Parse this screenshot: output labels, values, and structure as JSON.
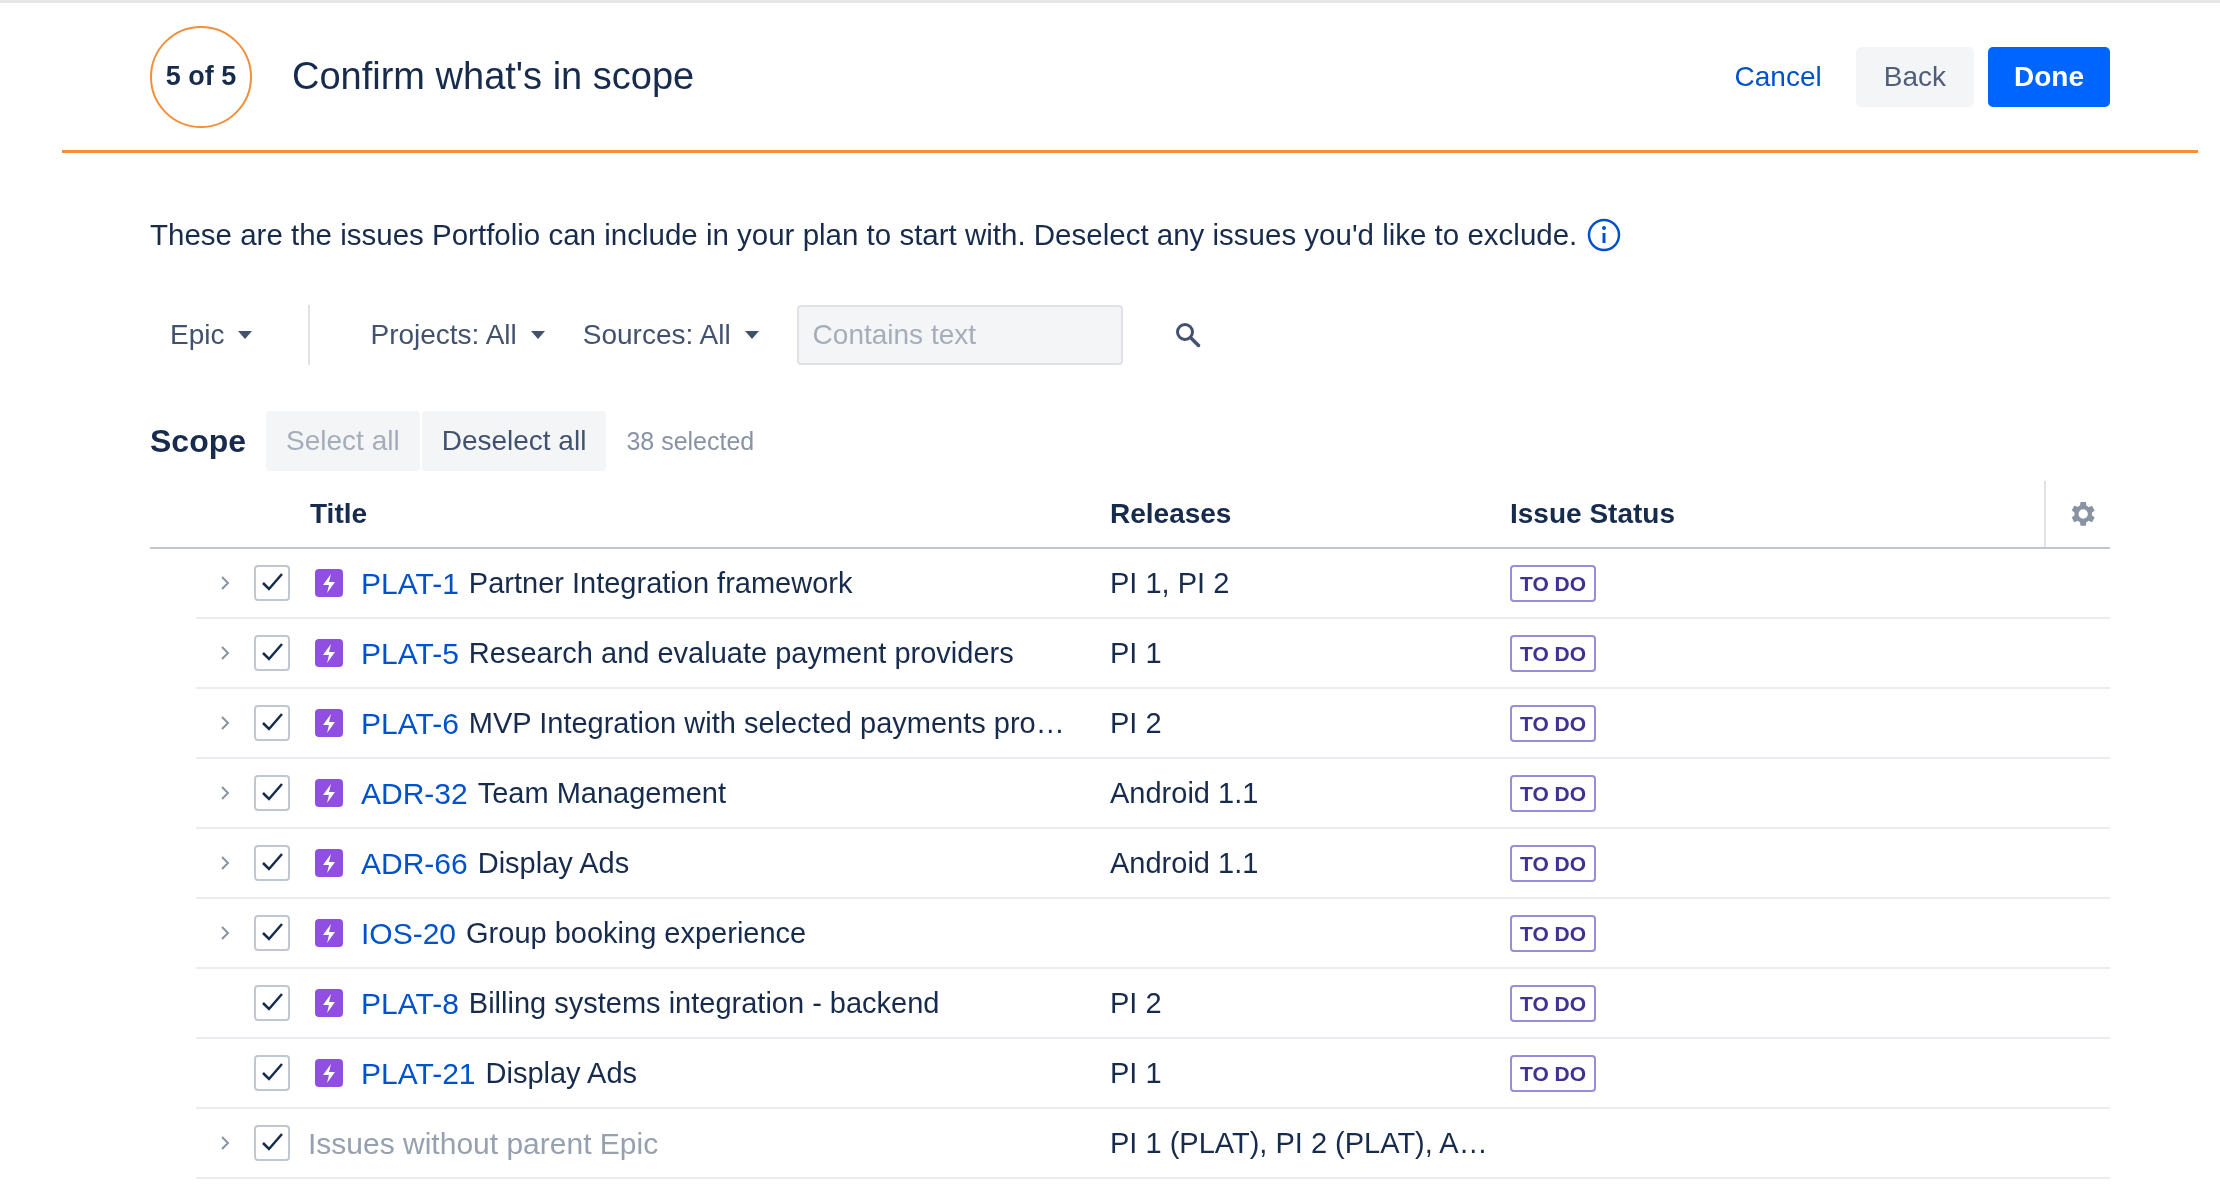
{
  "header": {
    "step": "5 of 5",
    "title": "Confirm what's in scope",
    "buttons": [
      {
        "label": "Cancel",
        "kind": "link"
      },
      {
        "label": "Back",
        "kind": "secondary"
      },
      {
        "label": "Done",
        "kind": "primary"
      }
    ]
  },
  "description": "These are the issues Portfolio can include in your plan to start with. Deselect any issues you'd like to exclude.",
  "filters": {
    "hierarchy": "Epic",
    "projects": "Projects: All",
    "sources": "Sources: All",
    "search": {
      "placeholder": "Contains text"
    }
  },
  "scope": {
    "title": "Scope",
    "actions": [
      {
        "label": "Select all",
        "disabled": true
      },
      {
        "label": "Deselect all",
        "disabled": false
      }
    ],
    "count": "38 selected"
  },
  "table": {
    "columns": [
      "Title",
      "Releases",
      "Issue Status"
    ],
    "rows": [
      {
        "kind": "epic",
        "has_children": true,
        "checked": true,
        "key": "PLAT-1",
        "title": "Partner Integration framework",
        "releases": "PI 1, PI 2",
        "status": "TO DO"
      },
      {
        "kind": "epic",
        "has_children": true,
        "checked": true,
        "key": "PLAT-5",
        "title": "Research and evaluate payment providers",
        "releases": "PI 1",
        "status": "TO DO"
      },
      {
        "kind": "epic",
        "has_children": true,
        "checked": true,
        "key": "PLAT-6",
        "title": "MVP Integration with selected payments pro…",
        "releases": "PI 2",
        "status": "TO DO"
      },
      {
        "kind": "epic",
        "has_children": true,
        "checked": true,
        "key": "ADR-32",
        "title": "Team Management",
        "releases": "Android 1.1",
        "status": "TO DO"
      },
      {
        "kind": "epic",
        "has_children": true,
        "checked": true,
        "key": "ADR-66",
        "title": "Display Ads",
        "releases": "Android 1.1",
        "status": "TO DO"
      },
      {
        "kind": "epic",
        "has_children": true,
        "checked": true,
        "key": "IOS-20",
        "title": "Group booking experience",
        "status": "TO DO"
      },
      {
        "kind": "epic",
        "has_children": false,
        "checked": true,
        "key": "PLAT-8",
        "title": "Billing systems integration - backend",
        "releases": "PI 2",
        "status": "TO DO"
      },
      {
        "kind": "epic",
        "has_children": false,
        "checked": true,
        "key": "PLAT-21",
        "title": "Display Ads",
        "releases": "PI 1",
        "status": "TO DO"
      },
      {
        "kind": "group",
        "has_children": true,
        "checked": true,
        "title": "Issues without parent Epic",
        "releases": "PI 1 (PLAT), PI 2 (PLAT), A…"
      }
    ]
  }
}
